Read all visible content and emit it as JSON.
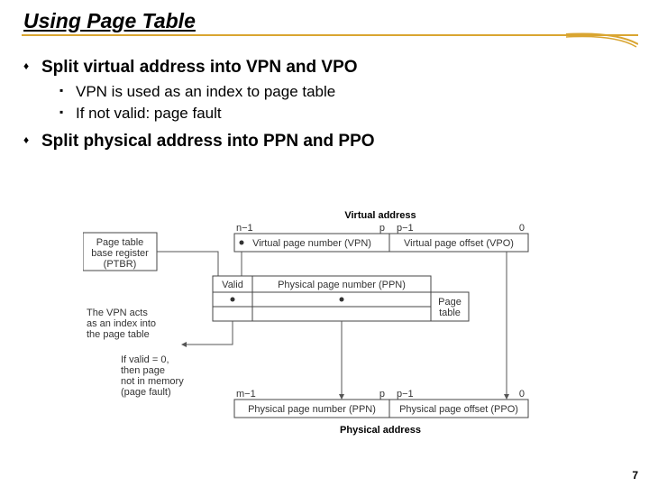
{
  "title": "Using Page Table",
  "bullets": {
    "b1": "Split virtual address into VPN and VPO",
    "b1_sub1": "VPN is used as an index to page table",
    "b1_sub2": "If not valid: page fault",
    "b2": "Split physical address into PPN and PPO"
  },
  "diagram": {
    "top_label": "Virtual address",
    "bottom_label": "Physical address",
    "ptbr_l1": "Page table",
    "ptbr_l2": "base register",
    "ptbr_l3": "(PTBR)",
    "vpn_full": "Virtual page number (VPN)",
    "vpo_full": "Virtual page offset (VPO)",
    "valid": "Valid",
    "ppn": "Physical page number (PPN)",
    "ppn_full": "Physical page number (PPN)",
    "ppo_full": "Physical page offset (PPO)",
    "pagetable": "Page",
    "pagetable2": "table",
    "vpn_note_l1": "The VPN acts",
    "vpn_note_l2": "as an index into",
    "vpn_note_l3": "the page table",
    "fault_l1": "If valid = 0,",
    "fault_l2": "then page",
    "fault_l3": "not in memory",
    "fault_l4": "(page fault)",
    "n_minus1": "n−1",
    "m_minus1": "m−1",
    "p": "p",
    "p_minus1": "p−1",
    "zero": "0"
  },
  "page_number": "7"
}
